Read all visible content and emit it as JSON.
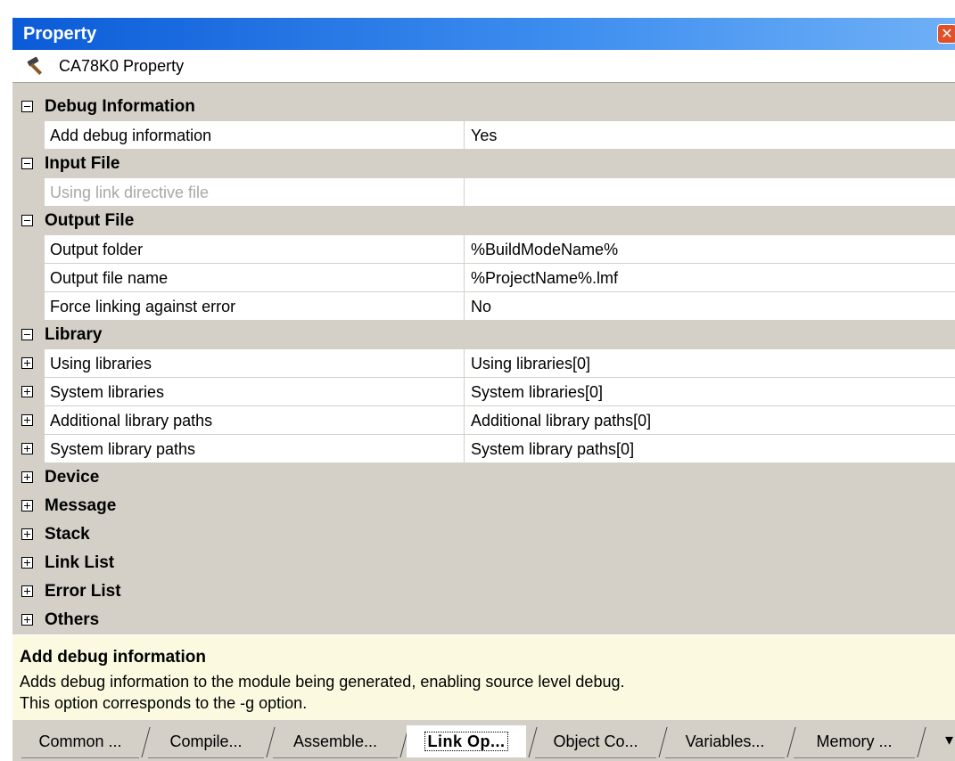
{
  "window": {
    "title": "Property",
    "close_glyph": "✕"
  },
  "header": {
    "icon": "hammer-icon",
    "label": "CA78K0 Property"
  },
  "grid": {
    "debug_info": {
      "category": "Debug Information",
      "add_debug_name": "Add debug information",
      "add_debug_value": "Yes"
    },
    "input_file": {
      "category": "Input File",
      "link_directive_name": "Using link directive file",
      "link_directive_value": ""
    },
    "output_file": {
      "category": "Output File",
      "output_folder_name": "Output folder",
      "output_folder_value": "%BuildModeName%",
      "output_file_name": "Output file name",
      "output_file_value": "%ProjectName%.lmf",
      "force_link_name": "Force linking against error",
      "force_link_value": "No"
    },
    "library": {
      "category": "Library",
      "using_libs_name": "Using libraries",
      "using_libs_value": "Using libraries[0]",
      "system_libs_name": "System libraries",
      "system_libs_value": "System libraries[0]",
      "additional_paths_name": "Additional library paths",
      "additional_paths_value": "Additional library paths[0]",
      "system_paths_name": "System library paths",
      "system_paths_value": "System library paths[0]"
    },
    "collapsed": {
      "device": "Device",
      "message": "Message",
      "stack": "Stack",
      "link_list": "Link List",
      "error_list": "Error List",
      "others": "Others"
    }
  },
  "description": {
    "title": "Add debug information",
    "line1": "Adds debug information to the module being generated, enabling source level debug.",
    "line2": "This option corresponds to the -g option."
  },
  "tabs": {
    "common": "Common ...",
    "compile": "Compile...",
    "assemble": "Assemble...",
    "link": "Link Op...",
    "object": "Object Co...",
    "variables": "Variables...",
    "memory": "Memory ...",
    "more_glyph": "▾"
  },
  "colors": {
    "titlebar": "#0b5bd8",
    "panel_bg": "#d4d0c8",
    "description_bg": "#fbfae0"
  }
}
